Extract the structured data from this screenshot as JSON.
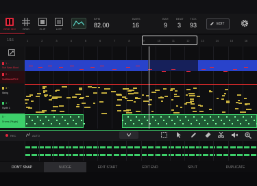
{
  "nav": {
    "items": [
      {
        "label": "GRID MIX"
      },
      {
        "label": "GRID"
      },
      {
        "label": "CLIP"
      },
      {
        "label": "LIST"
      }
    ]
  },
  "header": {
    "bpm_label": "BPM",
    "bpm_value": "82.00",
    "bars_label": "BARS",
    "bars_value": "16",
    "bar_label": "BAR",
    "bar_value": "9",
    "beat_label": "BEAT",
    "beat_value": "3",
    "tick_label": "TICK",
    "tick_value": "93",
    "edit_button": "EDIT"
  },
  "ruler": {
    "page_label": "1/16",
    "bar_numbers": [
      "1",
      "2",
      "3",
      "4",
      "5",
      "6",
      "7",
      "8",
      "9",
      "10",
      "11",
      "12",
      "13",
      "14",
      "15",
      "16"
    ]
  },
  "tracks": [
    {
      "label": "1 ·",
      "name": "Sub Bass Blunt"
    },
    {
      "label": "2 ·",
      "name": "SubBassMPK2"
    },
    {
      "label": "3 ·",
      "name": "String"
    },
    {
      "label": "4 ·",
      "name": "Synth 1"
    },
    {
      "label": "5 ·",
      "name": "Drums (Plugin)"
    }
  ],
  "automation": {
    "rec_label": "REC",
    "auto_label": "AUTO"
  },
  "bottom": {
    "dont_snap": "DON'T SNAP",
    "nudge": "NUDGE",
    "edit_start": "EDIT START",
    "edit_end": "EDIT END",
    "split": "SPLIT",
    "duplicate": "DUPLICATE"
  },
  "colors": {
    "accent_red": "#e0283c",
    "track_blue": "#2d4adf",
    "track_green": "#3dcf6a",
    "note_yellow": "#d9c043"
  }
}
